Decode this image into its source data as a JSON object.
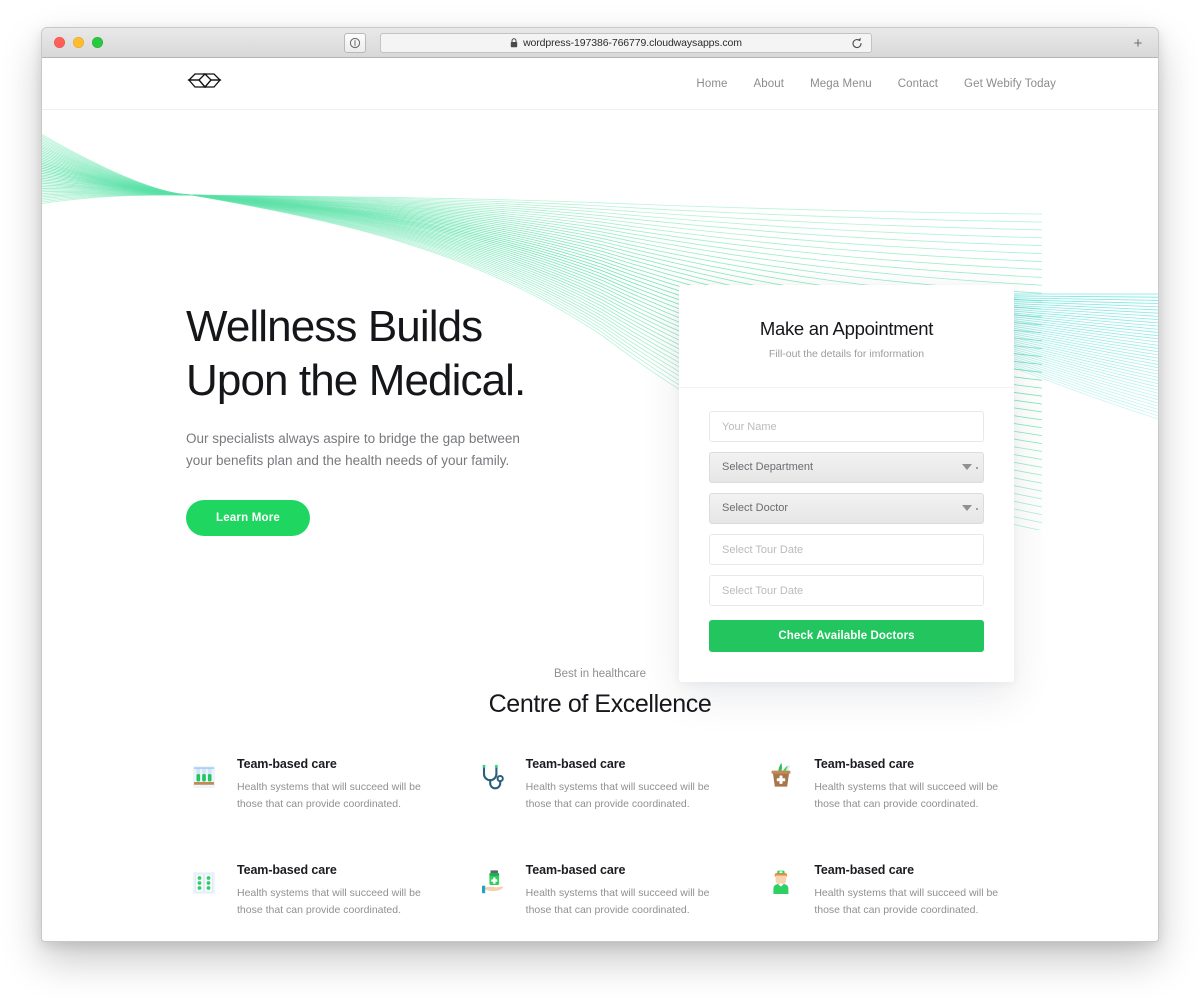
{
  "browser": {
    "url": "wordpress-197386-766779.cloudwaysapps.com",
    "lock_icon": "lock-icon",
    "reload_icon": "reload-icon",
    "shield_icon": "shield-icon",
    "new_tab_label": "+",
    "traffic_lights": [
      "close-red",
      "minimize-yellow",
      "zoom-green"
    ]
  },
  "site": {
    "logo_name": "webify-logo",
    "nav": [
      {
        "label": "Home"
      },
      {
        "label": "About"
      },
      {
        "label": "Mega Menu"
      },
      {
        "label": "Contact"
      },
      {
        "label": "Get Webify Today"
      }
    ]
  },
  "hero": {
    "title_line1": "Wellness Builds",
    "title_line2": "Upon the Medical.",
    "subtitle_line1": "Our specialists always aspire to bridge the gap between",
    "subtitle_line2": "your benefits plan and the health needs of your family.",
    "cta_label": "Learn More",
    "wave_color_left": "#3ddc97",
    "wave_color_right": "#4fe0d8"
  },
  "appointment": {
    "title": "Make an Appointment",
    "subtitle": "Fill-out the details for imformation",
    "fields": [
      {
        "name": "your-name-input",
        "placeholder": "Your Name",
        "type": "text"
      },
      {
        "name": "department-select",
        "placeholder": "Select Department",
        "type": "select"
      },
      {
        "name": "doctor-select",
        "placeholder": "Select Doctor",
        "type": "select"
      },
      {
        "name": "tour-date-input-1",
        "placeholder": "Select Tour Date",
        "type": "text"
      },
      {
        "name": "tour-date-input-2",
        "placeholder": "Select Tour Date",
        "type": "text"
      }
    ],
    "submit_label": "Check Available Doctors",
    "submit_color": "#22c55e"
  },
  "excellence": {
    "eyebrow": "Best in healthcare",
    "title": "Centre of Excellence",
    "features": [
      {
        "icon": "test-tubes-icon",
        "title": "Team-based care",
        "desc_line1": "Health systems that will succeed will be",
        "desc_line2": "those that can provide coordinated."
      },
      {
        "icon": "stethoscope-icon",
        "title": "Team-based care",
        "desc_line1": "Health systems that will succeed will be",
        "desc_line2": "those that can provide coordinated."
      },
      {
        "icon": "herbal-medicine-icon",
        "title": "Team-based care",
        "desc_line1": "Health systems that will succeed will be",
        "desc_line2": "those that can provide coordinated."
      },
      {
        "icon": "pill-blister-icon",
        "title": "Team-based care",
        "desc_line1": "Health systems that will succeed will be",
        "desc_line2": "those that can provide coordinated."
      },
      {
        "icon": "medicine-hand-icon",
        "title": "Team-based care",
        "desc_line1": "Health systems that will succeed will be",
        "desc_line2": "those that can provide coordinated."
      },
      {
        "icon": "nurse-icon",
        "title": "Team-based care",
        "desc_line1": "Health systems that will succeed will be",
        "desc_line2": "those that can provide coordinated."
      }
    ]
  }
}
